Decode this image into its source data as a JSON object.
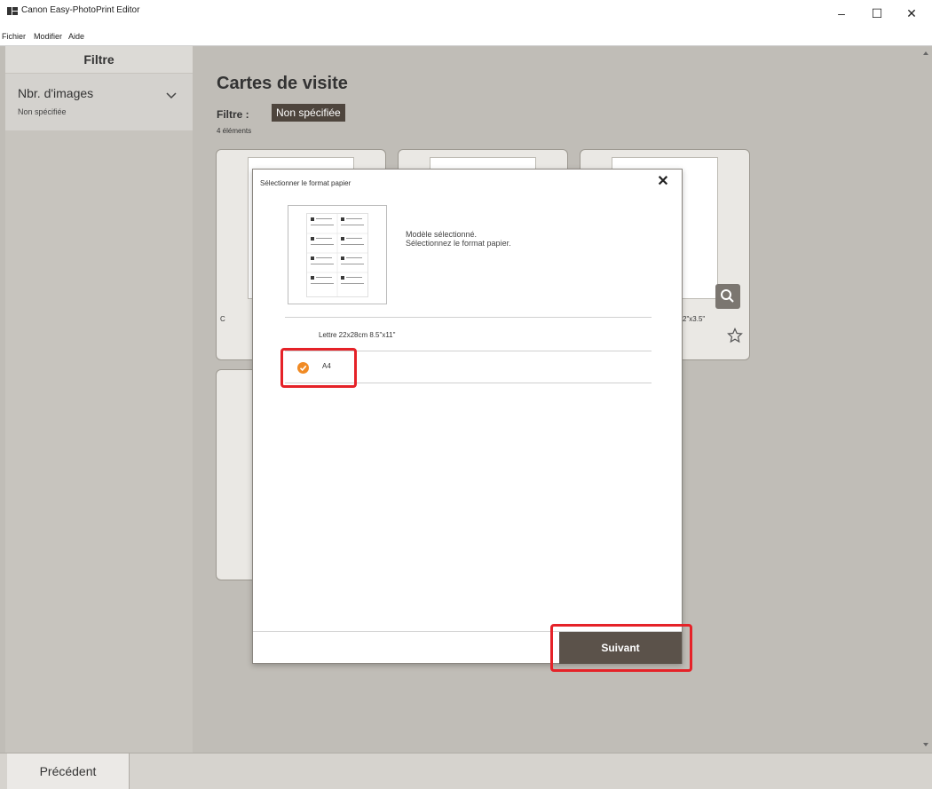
{
  "window": {
    "title": "Canon Easy-PhotoPrint Editor",
    "minimize": "–",
    "maximize": "☐",
    "close": "✕"
  },
  "menu": {
    "items": [
      "Fichier",
      "Modifier",
      "Aide"
    ]
  },
  "sidebar": {
    "header": "Filtre",
    "filter_label": "Nbr. d'images",
    "filter_value": "Non spécifiée"
  },
  "main": {
    "title": "Cartes de visite",
    "filter_label": "Filtre :",
    "filter_chip": "Non spécifiée",
    "count": "4 éléments",
    "card_left_text": "C",
    "card_right_text": "2\"x3.5\""
  },
  "dialog": {
    "title": "Sélectionner le format papier",
    "close": "✕",
    "message_line1": "Modèle sélectionné.",
    "message_line2": "Sélectionnez le format papier.",
    "options": [
      {
        "label": "Lettre 22x28cm 8.5\"x11\"",
        "selected": false
      },
      {
        "label": "A4",
        "selected": true
      }
    ],
    "next_label": "Suivant"
  },
  "footer": {
    "back_label": "Précédent"
  },
  "colors": {
    "accent": "#f08a24",
    "highlight": "#e52228",
    "button": "#5b524a"
  }
}
